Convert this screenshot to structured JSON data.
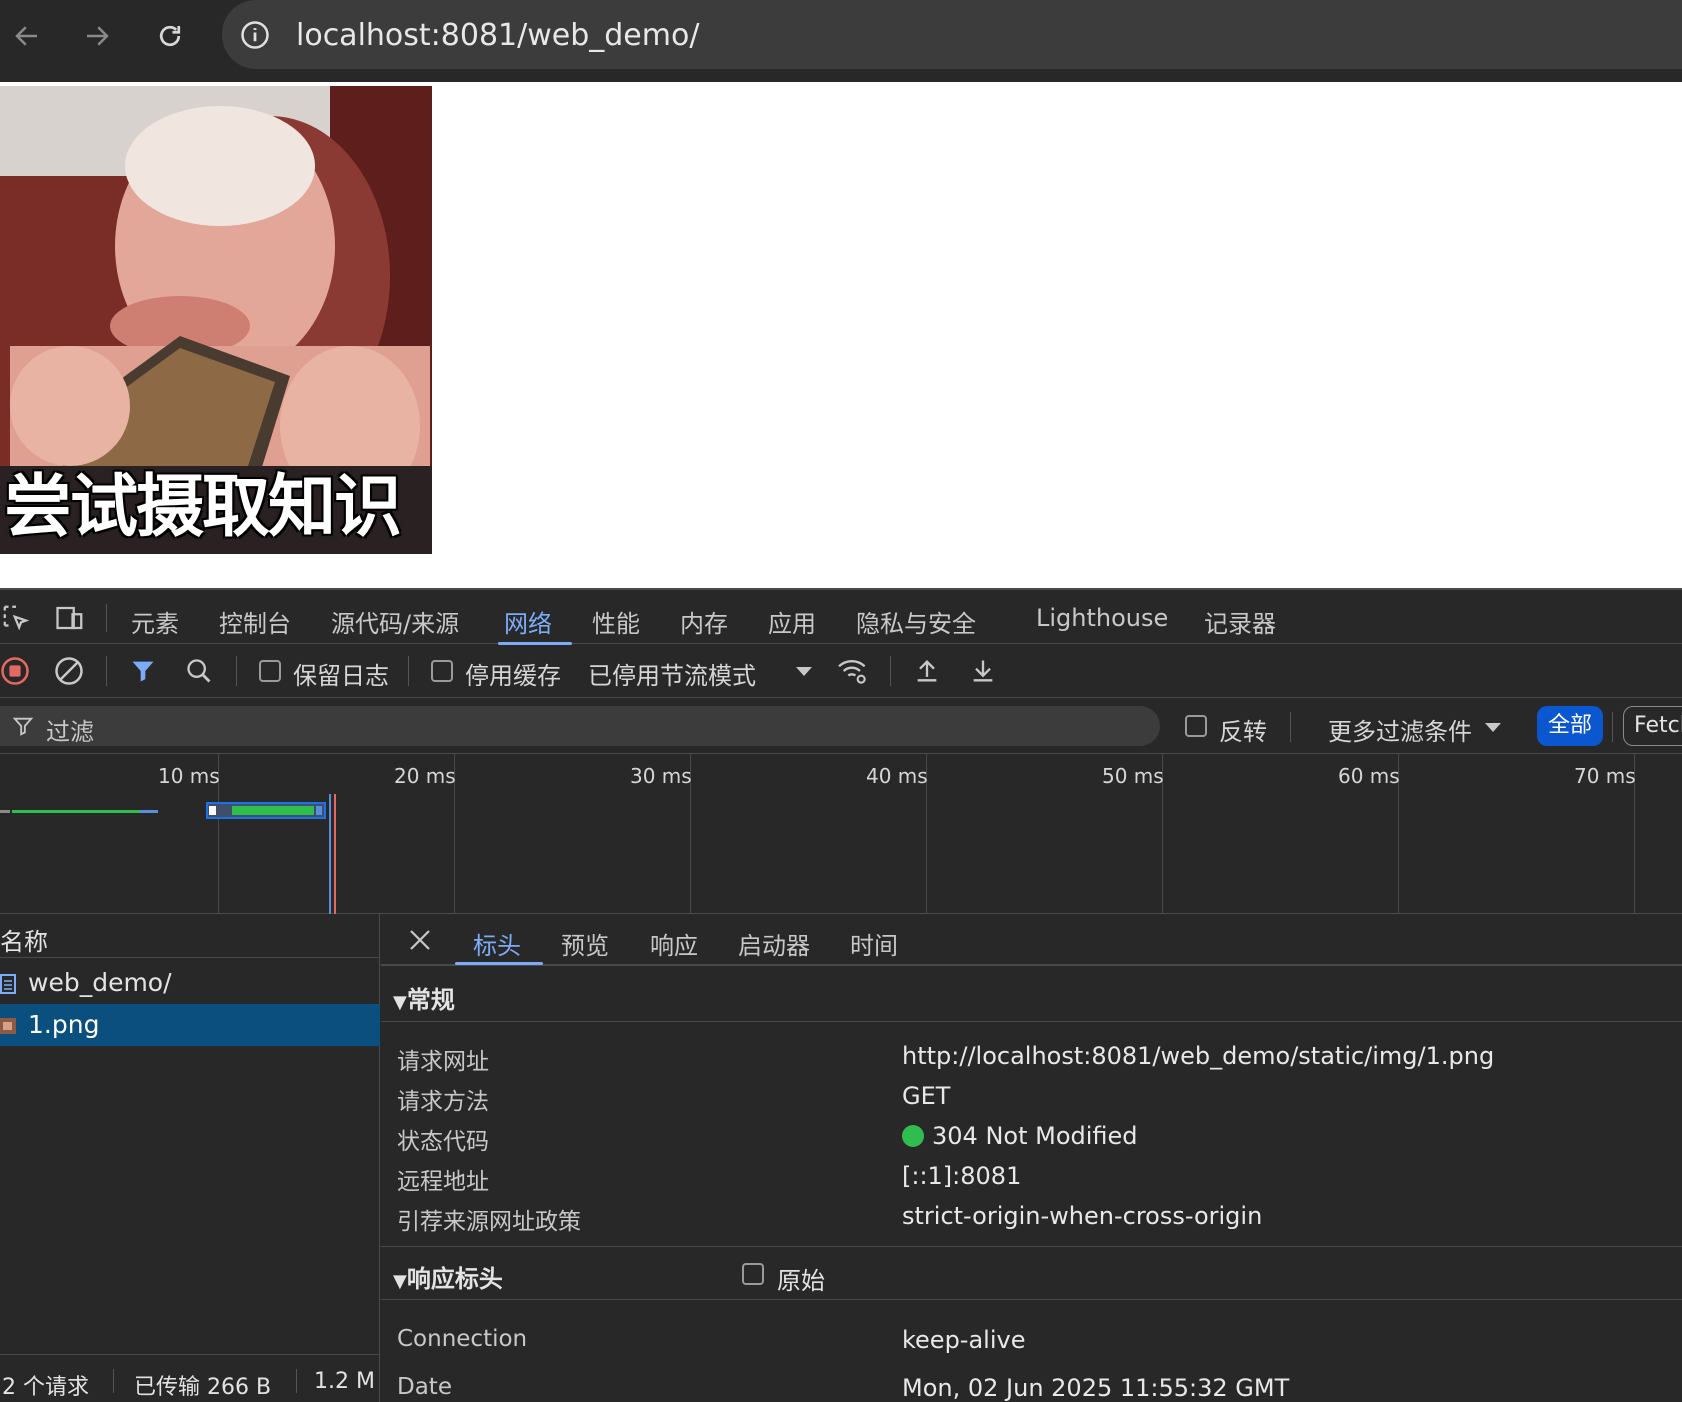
{
  "browser": {
    "url": "localhost:8081/web_demo/"
  },
  "page": {
    "meme_caption": "尝试摄取知识"
  },
  "devtools": {
    "tabs": [
      "元素",
      "控制台",
      "源代码/来源",
      "网络",
      "性能",
      "内存",
      "应用",
      "隐私与安全",
      "Lighthouse",
      "记录器"
    ],
    "active_tab": "网络",
    "toolbar": {
      "preserve_log": "保留日志",
      "disable_cache": "停用缓存",
      "throttling": "已停用节流模式"
    },
    "filter": {
      "placeholder": "过滤",
      "invert": "反转",
      "more_filters": "更多过滤条件",
      "all": "全部",
      "fetch": "Fetcl"
    },
    "timeline": {
      "ticks": [
        "10 ms",
        "20 ms",
        "30 ms",
        "40 ms",
        "50 ms",
        "60 ms",
        "70 ms"
      ]
    },
    "requests": {
      "header": "名称",
      "rows": [
        "web_demo/",
        "1.png"
      ],
      "selected_index": 1
    },
    "footer": {
      "requests": "2 个请求",
      "transferred": "已传输 266 B",
      "resources": "1.2 M"
    },
    "detail": {
      "tabs": [
        "标头",
        "预览",
        "响应",
        "启动器",
        "时间"
      ],
      "active_tab": "标头",
      "general_title": "常规",
      "general": [
        {
          "key": "请求网址",
          "value": "http://localhost:8081/web_demo/static/img/1.png"
        },
        {
          "key": "请求方法",
          "value": "GET"
        },
        {
          "key": "状态代码",
          "value": "304 Not Modified"
        },
        {
          "key": "远程地址",
          "value": "[::1]:8081"
        },
        {
          "key": "引荐来源网址政策",
          "value": "strict-origin-when-cross-origin"
        }
      ],
      "response_headers_title": "响应标头",
      "raw_label": "原始",
      "response_headers": [
        {
          "key": "Connection",
          "value": "keep-alive"
        },
        {
          "key": "Date",
          "value": "Mon, 02 Jun 2025 11:55:32 GMT"
        }
      ]
    }
  },
  "colors": {
    "accent": "#7cacf8",
    "selected_row": "#0b4f7f",
    "status_ok": "#2fbd4e",
    "record_red": "#e46962"
  }
}
